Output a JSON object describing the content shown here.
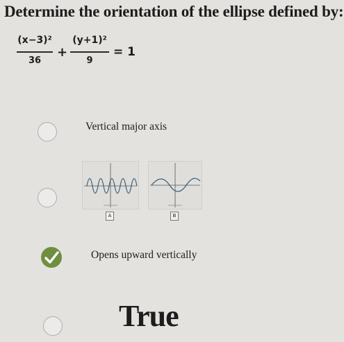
{
  "question": "Determine the orientation of the ellipse defined by:",
  "equation": {
    "term1_num": "(x−3)²",
    "term1_den": "36",
    "plus": "+",
    "term2_num": "(y+1)²",
    "term2_den": "9",
    "equals": "= 1"
  },
  "options": [
    {
      "label": "Vertical major axis",
      "selected": false
    },
    {
      "label": "",
      "selected": false,
      "graphs": [
        "A",
        "B"
      ]
    },
    {
      "label": "Opens upward vertically",
      "selected": true
    },
    {
      "label": "True",
      "selected": false
    }
  ],
  "colors": {
    "check": "#6f8f3f",
    "radio_border": "#a9aeb3",
    "background": "#e4e2df"
  }
}
